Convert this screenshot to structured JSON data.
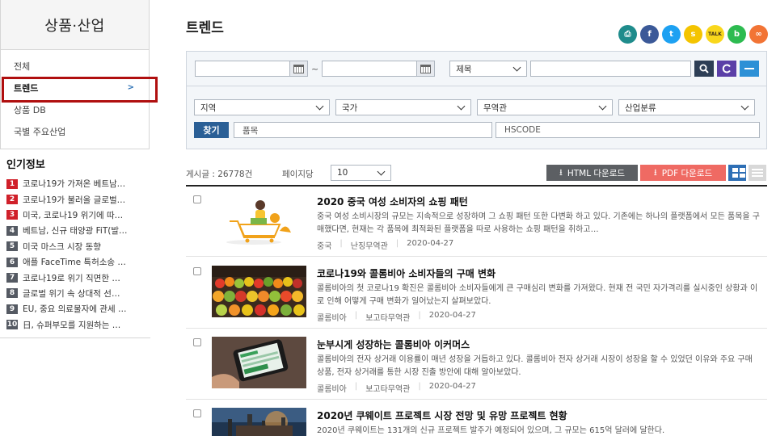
{
  "sidebar": {
    "title": "상품·산업",
    "menu": [
      {
        "label": "전체"
      },
      {
        "label": "트렌드",
        "chevron": ">"
      },
      {
        "label": "상품 DB"
      },
      {
        "label": "국별 주요산업"
      }
    ],
    "popular_title": "인기정보",
    "popular": [
      {
        "num": "1",
        "text": "코로나19가 가져온 베트남…"
      },
      {
        "num": "2",
        "text": "코로나19가 불러올 글로벌…"
      },
      {
        "num": "3",
        "text": "미국, 코로나19 위기에 따…"
      },
      {
        "num": "4",
        "text": "베트남, 신규 태양광 FiT(발…"
      },
      {
        "num": "5",
        "text": "미국 마스크 시장 동향"
      },
      {
        "num": "6",
        "text": "애플 FaceTime 특허소송 …"
      },
      {
        "num": "7",
        "text": "코로나19로 위기 직면한 …"
      },
      {
        "num": "8",
        "text": "글로벌 위기 속 상대적 선…"
      },
      {
        "num": "9",
        "text": "EU, 중요 의료물자에 관세 …"
      },
      {
        "num": "10",
        "text": "日, 슈퍼부모를 지원하는 …"
      }
    ]
  },
  "header": {
    "title": "트렌드",
    "share_icons": [
      {
        "name": "print-icon",
        "glyph": "⎙",
        "color": "#1f8c8c"
      },
      {
        "name": "facebook-icon",
        "glyph": "f",
        "color": "#3b5998"
      },
      {
        "name": "twitter-icon",
        "glyph": "t",
        "color": "#1da1f2"
      },
      {
        "name": "kakaostory-icon",
        "glyph": "s",
        "color": "#f4c400"
      },
      {
        "name": "kakaotalk-icon",
        "glyph": "TALK",
        "color": "#f9d71c"
      },
      {
        "name": "band-icon",
        "glyph": "b",
        "color": "#2dbb50"
      },
      {
        "name": "link-icon",
        "glyph": "∞",
        "color": "#f27435"
      }
    ]
  },
  "search": {
    "date_separator": "~",
    "field_select": "제목",
    "filters": [
      {
        "label": "지역"
      },
      {
        "label": "국가"
      },
      {
        "label": "무역관"
      },
      {
        "label": "산업분류"
      }
    ],
    "find_button": "찾기",
    "product_placeholder": "품목",
    "hscode_placeholder": "HSCODE",
    "colors": {
      "search_btn": "#2d3e55",
      "reset_btn": "#5b3fa7",
      "toggle_btn": "#2c90d6"
    }
  },
  "list": {
    "count_label": "게시글 : 26778건",
    "perpage_label": "페이지당",
    "perpage_value": "10",
    "html_download": "HTML 다운로드",
    "pdf_download": "PDF 다운로드",
    "items": [
      {
        "title": "2020 중국 여성 소비자의 쇼핑 패턴",
        "desc": "중국 여성 소비시장의 규모는 지속적으로 성장하며 그 쇼핑 패턴 또한 다변화 하고 있다. 기존에는 하나의 플랫폼에서 모든 품목을 구매했다면, 현재는 각 품목에 최적화된 플랫폼을 따로 사용하는 쇼핑 패턴을 취하고…",
        "country": "중국",
        "office": "난징무역관",
        "date": "2020-04-27",
        "thumb": "shopping-cart"
      },
      {
        "title": "코로나19와 콜롬비아 소비자들의 구매 변화",
        "desc": "콜롬비아의 첫 코로나19 확진은 콜롬비아 소비자들에게 큰 구매심리 변화를 가져왔다. 현재 전 국민 자가격리를 실시중인 상황과 이로 인해 어떻게 구매 변화가 일어났는지 살펴보았다.",
        "country": "콜롬비아",
        "office": "보고타무역관",
        "date": "2020-04-27",
        "thumb": "fruit-market"
      },
      {
        "title": "눈부시게 성장하는 콜롬비아 이커머스",
        "desc": "콜롬비아의 전자 상거래 이용률이 매년 성장을 거듭하고 있다. 콜롬비아 전자 상거래 시장이 성장을 할 수 있었던 이유와 주요 구매 상품, 전자 상거래를 통한 시장 진출 방안에 대해 알아보았다.",
        "country": "콜롬비아",
        "office": "보고타무역관",
        "date": "2020-04-27",
        "thumb": "smartphone"
      },
      {
        "title": "2020년 쿠웨이트 프로젝트 시장 전망 및 유망 프로젝트 현황",
        "desc": "2020년 쿠웨이트는 131개의 신규 프로젝트 발주가 예정되어 있으며, 그 규모는 615억 달러에 달한다.",
        "country": "",
        "office": "",
        "date": "",
        "thumb": "refinery"
      }
    ]
  }
}
